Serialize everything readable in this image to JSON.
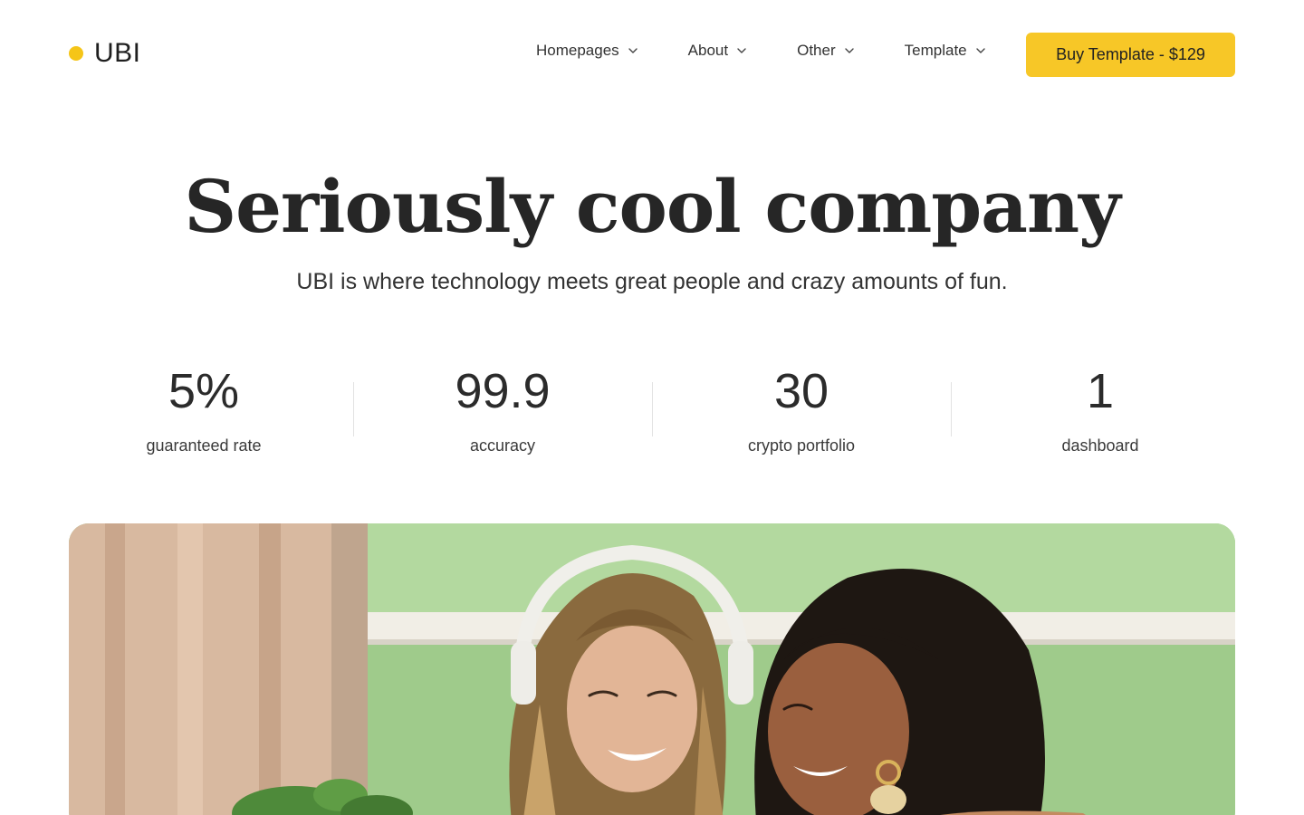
{
  "brand": {
    "name": "UBI",
    "accent_color": "#f5c518"
  },
  "nav": {
    "items": [
      {
        "label": "Homepages"
      },
      {
        "label": "About"
      },
      {
        "label": "Other"
      },
      {
        "label": "Template"
      }
    ],
    "cta_label": "Buy Template - $129",
    "cta_color": "#f7c727"
  },
  "hero": {
    "title": "Seriously cool company",
    "subtitle": "UBI is where technology meets great people and crazy amounts of fun."
  },
  "stats": [
    {
      "value": "5%",
      "label": "guaranteed rate"
    },
    {
      "value": "99.9",
      "label": "accuracy"
    },
    {
      "value": "30",
      "label": "crypto portfolio"
    },
    {
      "value": "1",
      "label": "dashboard"
    }
  ]
}
